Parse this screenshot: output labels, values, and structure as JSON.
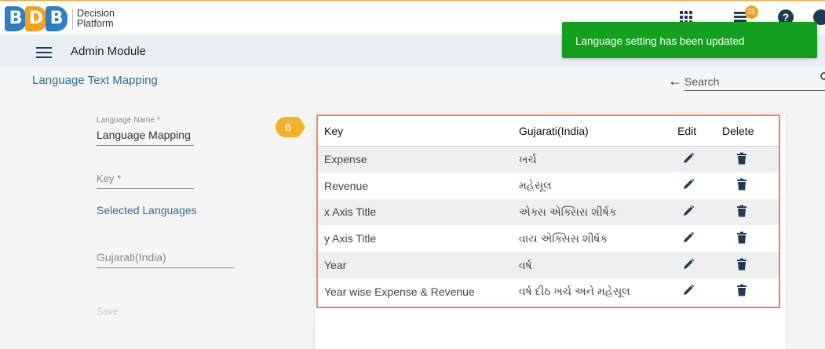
{
  "app": {
    "logo_letters": [
      "B",
      "D",
      "B"
    ],
    "brand_line1": "Decision",
    "brand_line2": "Platform",
    "notification_count": "35",
    "help_label": "?"
  },
  "module": {
    "title": "Admin Module"
  },
  "toast": {
    "message": "Language setting has been updated"
  },
  "page": {
    "title": "Language Text Mapping",
    "search_placeholder": "Search"
  },
  "form": {
    "language_name_label": "Language Name *",
    "language_name_value": "Language Mapping",
    "key_placeholder": "Key *",
    "selected_languages_label": "Selected Languages",
    "language_field_value": "Gujarati(India)",
    "save_label": "Save"
  },
  "step_badge": "6",
  "table": {
    "headers": {
      "key": "Key",
      "value": "Gujarati(India)",
      "edit": "Edit",
      "delete": "Delete"
    },
    "rows": [
      {
        "key": "Expense",
        "value": "ખર્ચ"
      },
      {
        "key": "Revenue",
        "value": "મહેસૂલ"
      },
      {
        "key": "x Axis Title",
        "value": "એક્સ એક્સિસ શીર્ષક"
      },
      {
        "key": "y Axis Title",
        "value": "વાય એક્સિસ શીર્ષક"
      },
      {
        "key": "Year",
        "value": "વર્ષ"
      },
      {
        "key": "Year wise Expense & Revenue",
        "value": "વર્ષ દીઠ ખર્ચ અને મહેસૂલ"
      }
    ]
  },
  "colors": {
    "accent_blue": "#2a6f9b",
    "toast_green": "#14a01e",
    "highlight_orange": "#e8845c",
    "badge_yellow": "#f3b22c"
  }
}
